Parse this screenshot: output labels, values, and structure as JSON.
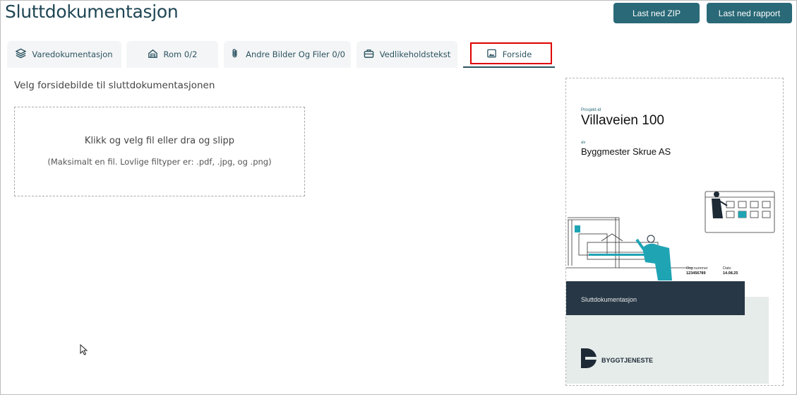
{
  "page": {
    "title": "Sluttdokumentasjon"
  },
  "toolbar": {
    "download_zip": "Last ned ZIP",
    "download_report": "Last ned rapport"
  },
  "tabs": [
    {
      "label": "Varedokumentasjon",
      "icon": "layers-icon"
    },
    {
      "label": "Rom 0/2",
      "icon": "house-icon"
    },
    {
      "label": "Andre Bilder Og Filer 0/0",
      "icon": "paperclip-icon"
    },
    {
      "label": "Vedlikeholdstekst",
      "icon": "toolbox-icon"
    },
    {
      "label": "Forside",
      "icon": "image-icon",
      "active": true
    }
  ],
  "main": {
    "heading": "Velg forsidebilde til sluttdokumentasjonen",
    "dropzone": {
      "title": "Klikk og velg fil eller dra og slipp",
      "subtitle": "(Maksimalt en fil. Lovlige filtyper er: .pdf, .jpg, og .png)"
    }
  },
  "preview": {
    "project_id_label": "Prosjekt-id",
    "project_name": "Villaveien 100",
    "by_label": "av",
    "company": "Byggmester Skrue AS",
    "org_label": "Org.nummer",
    "org_value": "123456789",
    "date_label": "Dato",
    "date_value": "14.08.25",
    "band_text": "Sluttdokumentasjon",
    "logo_text": "BYGGTJENESTE"
  },
  "colors": {
    "accent": "#2a6977",
    "title": "#1f4654",
    "highlight": "#e00000",
    "band": "#273746"
  }
}
